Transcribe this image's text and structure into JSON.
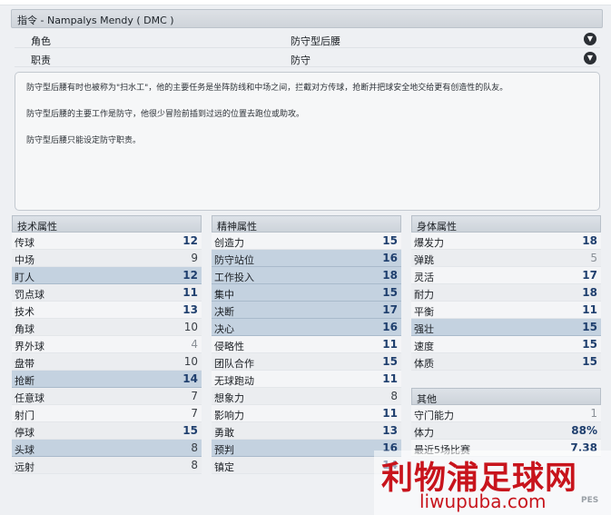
{
  "header": {
    "title": "指令 - Nampalys Mendy ( DMC )"
  },
  "role": {
    "label": "角色",
    "value": "防守型后腰"
  },
  "duty": {
    "label": "职责",
    "value": "防守"
  },
  "description": [
    "防守型后腰有时也被称为\"扫水工\"，他的主要任务是坐阵防线和中场之间，拦截对方传球，抢断并把球安全地交给更有创造性的队友。",
    "防守型后腰的主要工作是防守，他很少冒险前插到过远的位置去跑位或助攻。",
    "防守型后腰只能设定防守职责。"
  ],
  "technical": {
    "title": "技术属性",
    "items": [
      {
        "name": "传球",
        "value": "12",
        "hl": false
      },
      {
        "name": "中场",
        "value": "9",
        "hl": false
      },
      {
        "name": "盯人",
        "value": "12",
        "hl": true
      },
      {
        "name": "罚点球",
        "value": "11",
        "hl": false
      },
      {
        "name": "技术",
        "value": "13",
        "hl": false
      },
      {
        "name": "角球",
        "value": "10",
        "hl": false
      },
      {
        "name": "界外球",
        "value": "4",
        "hl": false
      },
      {
        "name": "盘带",
        "value": "10",
        "hl": false
      },
      {
        "name": "抢断",
        "value": "14",
        "hl": true
      },
      {
        "name": "任意球",
        "value": "7",
        "hl": false
      },
      {
        "name": "射门",
        "value": "7",
        "hl": false
      },
      {
        "name": "停球",
        "value": "15",
        "hl": false
      },
      {
        "name": "头球",
        "value": "8",
        "hl": true
      },
      {
        "name": "远射",
        "value": "8",
        "hl": false
      }
    ]
  },
  "mental": {
    "title": "精神属性",
    "items": [
      {
        "name": "创造力",
        "value": "15",
        "hl": false
      },
      {
        "name": "防守站位",
        "value": "16",
        "hl": true
      },
      {
        "name": "工作投入",
        "value": "18",
        "hl": true
      },
      {
        "name": "集中",
        "value": "15",
        "hl": true
      },
      {
        "name": "决断",
        "value": "17",
        "hl": true
      },
      {
        "name": "决心",
        "value": "16",
        "hl": true
      },
      {
        "name": "侵略性",
        "value": "11",
        "hl": false
      },
      {
        "name": "团队合作",
        "value": "15",
        "hl": false
      },
      {
        "name": "无球跑动",
        "value": "11",
        "hl": false
      },
      {
        "name": "想象力",
        "value": "8",
        "hl": false
      },
      {
        "name": "影响力",
        "value": "11",
        "hl": false
      },
      {
        "name": "勇敢",
        "value": "13",
        "hl": false
      },
      {
        "name": "预判",
        "value": "16",
        "hl": true
      },
      {
        "name": "镇定",
        "value": "14",
        "hl": false
      }
    ]
  },
  "physical": {
    "title": "身体属性",
    "items": [
      {
        "name": "爆发力",
        "value": "18",
        "hl": false
      },
      {
        "name": "弹跳",
        "value": "5",
        "hl": false
      },
      {
        "name": "灵活",
        "value": "17",
        "hl": false
      },
      {
        "name": "耐力",
        "value": "18",
        "hl": false
      },
      {
        "name": "平衡",
        "value": "11",
        "hl": false
      },
      {
        "name": "强壮",
        "value": "15",
        "hl": true
      },
      {
        "name": "速度",
        "value": "15",
        "hl": false
      },
      {
        "name": "体质",
        "value": "15",
        "hl": false
      }
    ]
  },
  "other": {
    "title": "其他",
    "items": [
      {
        "name": "守门能力",
        "value": "1",
        "hl": false
      },
      {
        "name": "体力",
        "value": "88%",
        "hl": false
      },
      {
        "name": "最近5场比赛",
        "value": "7.38",
        "hl": false
      }
    ]
  },
  "watermark": {
    "main": "利物浦足球网",
    "url": "liwupuba.com",
    "tag": "PES"
  },
  "colors": {
    "highlight": "#c4d2e0",
    "value": "#1f3f6e",
    "watermark": "#c8141c"
  }
}
